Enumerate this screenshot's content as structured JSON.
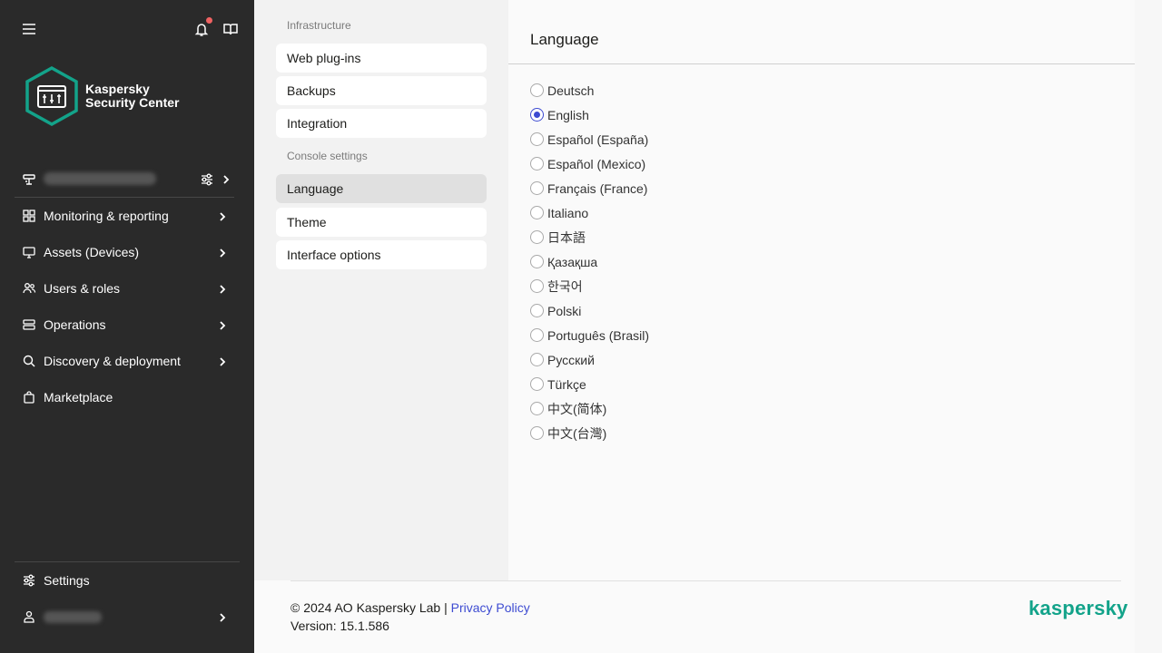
{
  "colors": {
    "sidebar_bg": "#2a2a2a",
    "accent_teal": "#13a38a",
    "link_blue": "#3d4bd1",
    "notification_dot": "#f06262"
  },
  "sidebar": {
    "brand_line1": "Kaspersky",
    "brand_line2": "Security Center",
    "nav_items": [
      {
        "label": "Monitoring & reporting",
        "icon": "dashboard-icon"
      },
      {
        "label": "Assets (Devices)",
        "icon": "monitor-icon"
      },
      {
        "label": "Users & roles",
        "icon": "users-icon"
      },
      {
        "label": "Operations",
        "icon": "stack-icon"
      },
      {
        "label": "Discovery & deployment",
        "icon": "search-icon"
      },
      {
        "label": "Marketplace",
        "icon": "bag-icon"
      }
    ],
    "settings_label": "Settings"
  },
  "middle": {
    "infrastructure_heading": "Infrastructure",
    "infrastructure_items": [
      "Web plug-ins",
      "Backups",
      "Integration"
    ],
    "console_heading": "Console settings",
    "console_items": [
      "Language",
      "Theme",
      "Interface options"
    ],
    "active_item": "Language"
  },
  "content": {
    "title": "Language",
    "languages": [
      {
        "label": "Deutsch",
        "selected": false
      },
      {
        "label": "English",
        "selected": true
      },
      {
        "label": "Español (España)",
        "selected": false
      },
      {
        "label": "Español (Mexico)",
        "selected": false
      },
      {
        "label": "Français (France)",
        "selected": false
      },
      {
        "label": "Italiano",
        "selected": false
      },
      {
        "label": "日本語",
        "selected": false
      },
      {
        "label": "Қазақша",
        "selected": false
      },
      {
        "label": "한국어",
        "selected": false
      },
      {
        "label": "Polski",
        "selected": false
      },
      {
        "label": "Português (Brasil)",
        "selected": false
      },
      {
        "label": "Русский",
        "selected": false
      },
      {
        "label": "Türkçe",
        "selected": false
      },
      {
        "label": "中文(简体)",
        "selected": false
      },
      {
        "label": "中文(台灣)",
        "selected": false
      }
    ]
  },
  "footer": {
    "copyright": "© 2024 AO Kaspersky Lab |",
    "privacy_link": "Privacy Policy",
    "version": "Version: 15.1.586",
    "logo_text": "kaspersky"
  }
}
